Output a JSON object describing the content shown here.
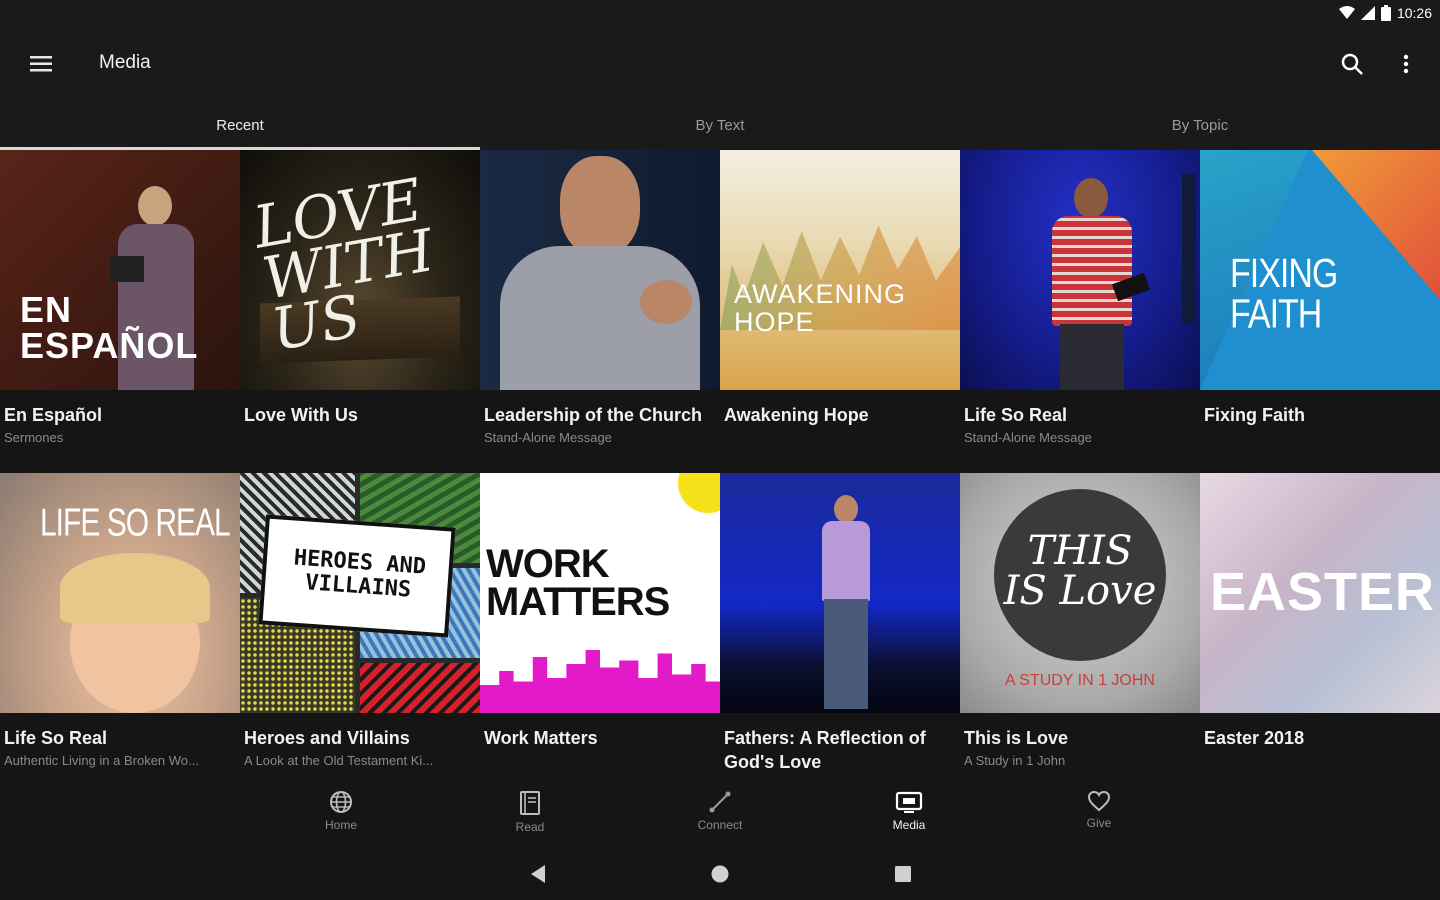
{
  "status_bar": {
    "time": "10:26"
  },
  "app_bar": {
    "title": "Media"
  },
  "tabs": [
    {
      "label": "Recent",
      "active": true
    },
    {
      "label": "By Text",
      "active": false
    },
    {
      "label": "By Topic",
      "active": false
    }
  ],
  "cards": [
    {
      "title": "En Español",
      "subtitle": "Sermones",
      "art": "EN\nESPAÑOL"
    },
    {
      "title": "Love With Us",
      "subtitle": "",
      "art": "LOVE WITH US"
    },
    {
      "title": "Leadership of the Church",
      "subtitle": "Stand-Alone Message",
      "art": ""
    },
    {
      "title": "Awakening Hope",
      "subtitle": "",
      "art": "AWAKENING HOPE"
    },
    {
      "title": "Life So Real",
      "subtitle": "Stand-Alone Message",
      "art": ""
    },
    {
      "title": "Fixing Faith",
      "subtitle": "",
      "art": "FIXING FAITH"
    },
    {
      "title": "Life So Real",
      "subtitle": "Authentic Living in a Broken Wo...",
      "art": "LIFE SO REAL"
    },
    {
      "title": "Heroes and Villains",
      "subtitle": "A Look at the Old Testament Ki...",
      "art": "HEROES AND VILLAINS"
    },
    {
      "title": "Work Matters",
      "subtitle": "",
      "art": "WORK MATTERS"
    },
    {
      "title": "Fathers: A Reflection of God's Love",
      "subtitle": "",
      "art": ""
    },
    {
      "title": "This is Love",
      "subtitle": "A Study in 1 John",
      "art": "THIS IS Love",
      "art_sub": "A STUDY IN 1 JOHN"
    },
    {
      "title": "Easter 2018",
      "subtitle": "",
      "art": "EASTER"
    }
  ],
  "bottom_nav": [
    {
      "label": "Home",
      "icon": "globe-icon",
      "active": false
    },
    {
      "label": "Read",
      "icon": "book-icon",
      "active": false
    },
    {
      "label": "Connect",
      "icon": "connect-icon",
      "active": false
    },
    {
      "label": "Media",
      "icon": "tv-icon",
      "active": true
    },
    {
      "label": "Give",
      "icon": "heart-icon",
      "active": false
    }
  ],
  "colors": {
    "background": "#1a1a1a",
    "card_background": "#151515",
    "text_primary": "#f2f2f2",
    "text_secondary": "#8a8a8a",
    "tab_indicator": "#d8d8d8"
  }
}
